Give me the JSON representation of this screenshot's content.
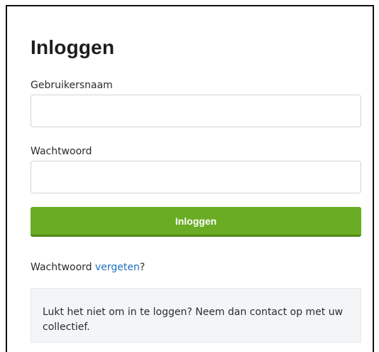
{
  "login": {
    "title": "Inloggen",
    "username_label": "Gebruikersnaam",
    "username_value": "",
    "password_label": "Wachtwoord",
    "password_value": "",
    "submit_label": "Inloggen",
    "forgot_prefix": "Wachtwoord ",
    "forgot_link": "vergeten",
    "forgot_suffix": "?",
    "help_text": "Lukt het niet om in te loggen? Neem dan contact op met uw collectief."
  },
  "colors": {
    "button_background": "#6aac24",
    "link": "#1f6fbf",
    "help_background": "#f4f5f7"
  }
}
